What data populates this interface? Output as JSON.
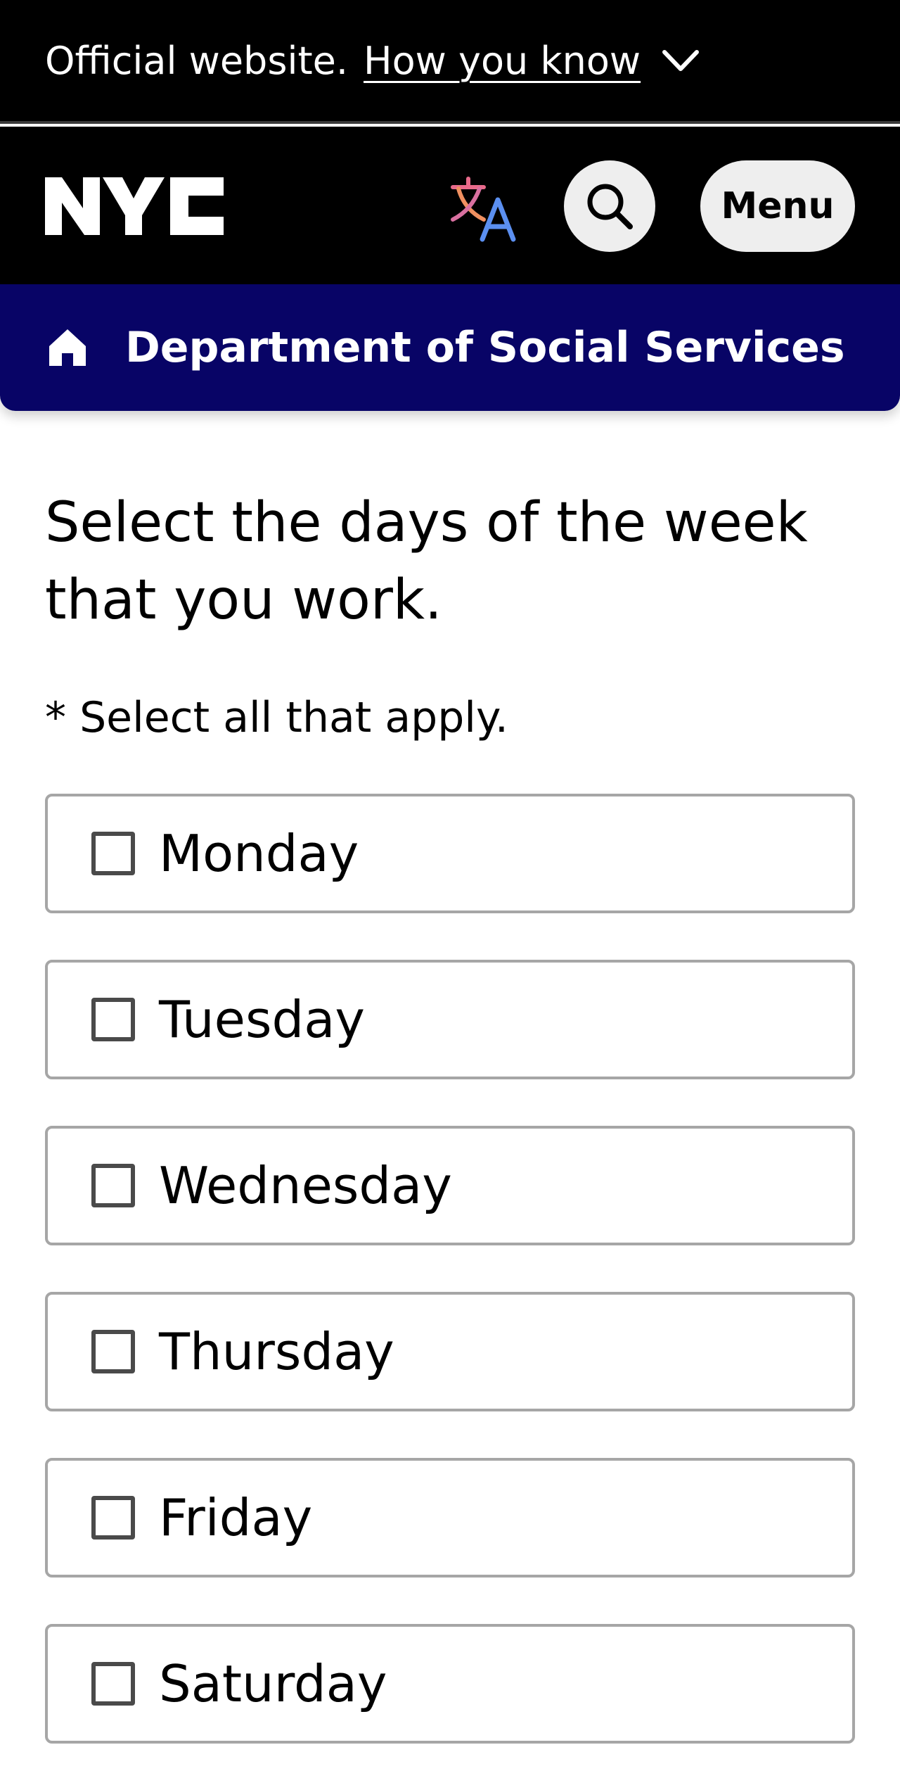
{
  "banner": {
    "official_text": "Official website.",
    "how_link": "How you know"
  },
  "header": {
    "logo": "NYC",
    "translate_icon": "translate-icon",
    "search_icon": "search-icon",
    "menu_label": "Menu"
  },
  "agency": {
    "home_icon": "home-icon",
    "name": "Department of Social Services"
  },
  "form": {
    "question": "Select the days of the week that you work.",
    "hint": "* Select all that apply.",
    "options": [
      {
        "label": "Monday",
        "checked": false
      },
      {
        "label": "Tuesday",
        "checked": false
      },
      {
        "label": "Wednesday",
        "checked": false
      },
      {
        "label": "Thursday",
        "checked": false
      },
      {
        "label": "Friday",
        "checked": false
      },
      {
        "label": "Saturday",
        "checked": false
      }
    ]
  },
  "colors": {
    "banner_bg": "#000000",
    "agency_bg": "#080466",
    "button_bg": "#eeeeee",
    "option_border": "#a6a6a6"
  }
}
